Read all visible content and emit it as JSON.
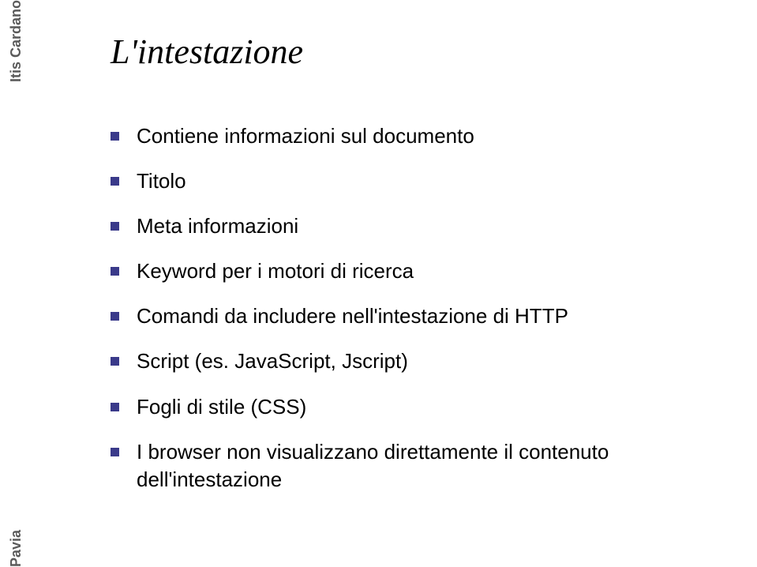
{
  "sidebar": {
    "top_label": "Itis Cardano",
    "bottom_label": "Pavia"
  },
  "slide": {
    "title": "L'intestazione",
    "bullets": [
      "Contiene informazioni sul documento",
      "Titolo",
      "Meta informazioni",
      "Keyword per i motori di ricerca",
      "Comandi da includere nell'intestazione di HTTP",
      "Script (es. JavaScript, Jscript)",
      "Fogli di stile (CSS)",
      "I browser non visualizzano direttamente il contenuto dell'intestazione"
    ]
  }
}
